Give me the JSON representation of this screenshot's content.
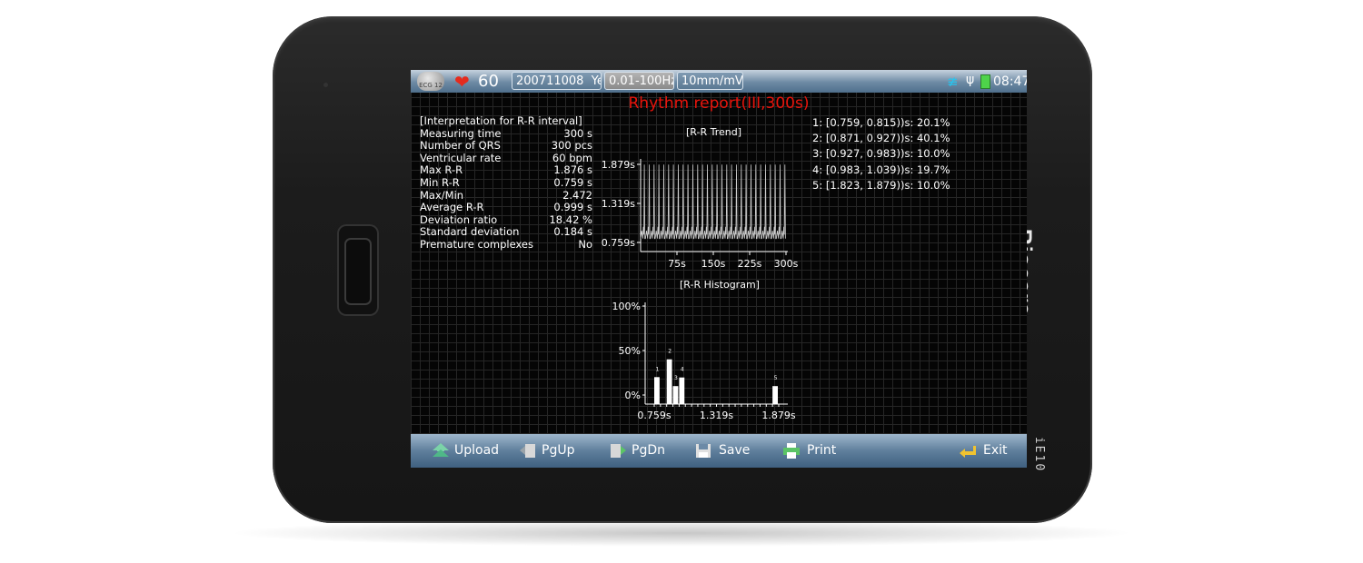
{
  "device": {
    "brand": "Biocare",
    "model": "iE10"
  },
  "status_bar": {
    "mode_icon_label": "ECG 12",
    "heart_rate": "60",
    "patient_id": "200711008",
    "patient_id_suffix": "Ye",
    "filter": "0.01-100Hz",
    "gain": "10mm/mV",
    "time": "08:47"
  },
  "report": {
    "title": "Rhythm report(III,300s)",
    "interpretation_header": "[Interpretation for R-R interval]",
    "rows": [
      {
        "label": "Measuring time",
        "value": "300 s"
      },
      {
        "label": "Number of QRS",
        "value": "300 pcs"
      },
      {
        "label": "Ventricular rate",
        "value": "60 bpm"
      },
      {
        "label": "Max R-R",
        "value": "1.876 s"
      },
      {
        "label": "Min R-R",
        "value": "0.759 s"
      },
      {
        "label": "Max/Min",
        "value": "2.472"
      },
      {
        "label": "Average R-R",
        "value": "0.999 s"
      },
      {
        "label": "Deviation ratio",
        "value": "18.42 %"
      },
      {
        "label": "Standard deviation",
        "value": "0.184 s"
      },
      {
        "label": "Premature complexes",
        "value": "No"
      }
    ],
    "bins": [
      "1: [0.759, 0.815))s: 20.1%",
      "2: [0.871, 0.927))s: 40.1%",
      "3: [0.927, 0.983))s: 10.0%",
      "4: [0.983, 1.039))s: 19.7%",
      "5: [1.823, 1.879))s: 10.0%"
    ]
  },
  "chart_data": [
    {
      "type": "line",
      "title": "[R-R Trend]",
      "x_ticks": [
        "75s",
        "150s",
        "225s",
        "300s"
      ],
      "y_ticks": [
        "1.879s",
        "1.319s",
        "0.759s"
      ],
      "xlim": [
        0,
        300
      ],
      "ylim": [
        0.759,
        1.879
      ],
      "pattern": "repeating R-R spikes: baseline ~0.8-0.93 s with periodic peaks to ~1.876 s",
      "baseline_levels": [
        0.815,
        0.871,
        0.927,
        0.983
      ],
      "peak_value": 1.876,
      "peak_count": 30,
      "grid": true
    },
    {
      "type": "bar",
      "title": "[R-R Histogram]",
      "x_ticks": [
        "0.759s",
        "1.319s",
        "1.879s"
      ],
      "y_ticks": [
        "100%",
        "50%",
        "0%"
      ],
      "xlim": [
        0.759,
        1.879
      ],
      "ylim": [
        0,
        100
      ],
      "bars": [
        {
          "label": "1",
          "x_start": 0.759,
          "x_end": 0.815,
          "value": 20.1
        },
        {
          "label": "2",
          "x_start": 0.871,
          "x_end": 0.927,
          "value": 40.1
        },
        {
          "label": "3",
          "x_start": 0.927,
          "x_end": 0.983,
          "value": 10.0
        },
        {
          "label": "4",
          "x_start": 0.983,
          "x_end": 1.039,
          "value": 19.7
        },
        {
          "label": "5",
          "x_start": 1.823,
          "x_end": 1.879,
          "value": 10.0
        }
      ],
      "grid": true
    }
  ],
  "toolbar": {
    "upload": "Upload",
    "pgup": "PgUp",
    "pgdn": "PgDn",
    "save": "Save",
    "print": "Print",
    "exit": "Exit"
  }
}
